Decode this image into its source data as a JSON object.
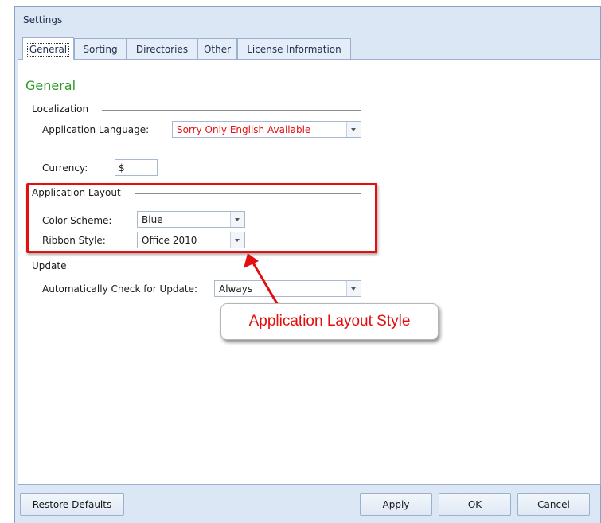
{
  "window": {
    "title": "Settings"
  },
  "tabs": [
    {
      "label": "General"
    },
    {
      "label": "Sorting"
    },
    {
      "label": "Directories"
    },
    {
      "label": "Other"
    },
    {
      "label": "License Information"
    }
  ],
  "general": {
    "heading": "General",
    "localization": {
      "group_label": "Localization",
      "language_label": "Application Language:",
      "language_value": "Sorry Only English Available",
      "currency_label": "Currency:",
      "currency_value": "$"
    },
    "layout": {
      "group_label": "Application Layout",
      "color_scheme_label": "Color Scheme:",
      "color_scheme_value": "Blue",
      "ribbon_style_label": "Ribbon Style:",
      "ribbon_style_value": "Office 2010"
    },
    "update": {
      "group_label": "Update",
      "auto_check_label": "Automatically Check for Update:",
      "auto_check_value": "Always"
    }
  },
  "annotation": {
    "callout_text": "Application Layout Style"
  },
  "buttons": {
    "restore_defaults": "Restore Defaults",
    "apply": "Apply",
    "ok": "OK",
    "cancel": "Cancel"
  },
  "colors": {
    "heading_green": "#2b9a27",
    "language_red": "#e30f0f",
    "annotation_red": "#e30f0f",
    "window_bg": "#dce7f5"
  }
}
